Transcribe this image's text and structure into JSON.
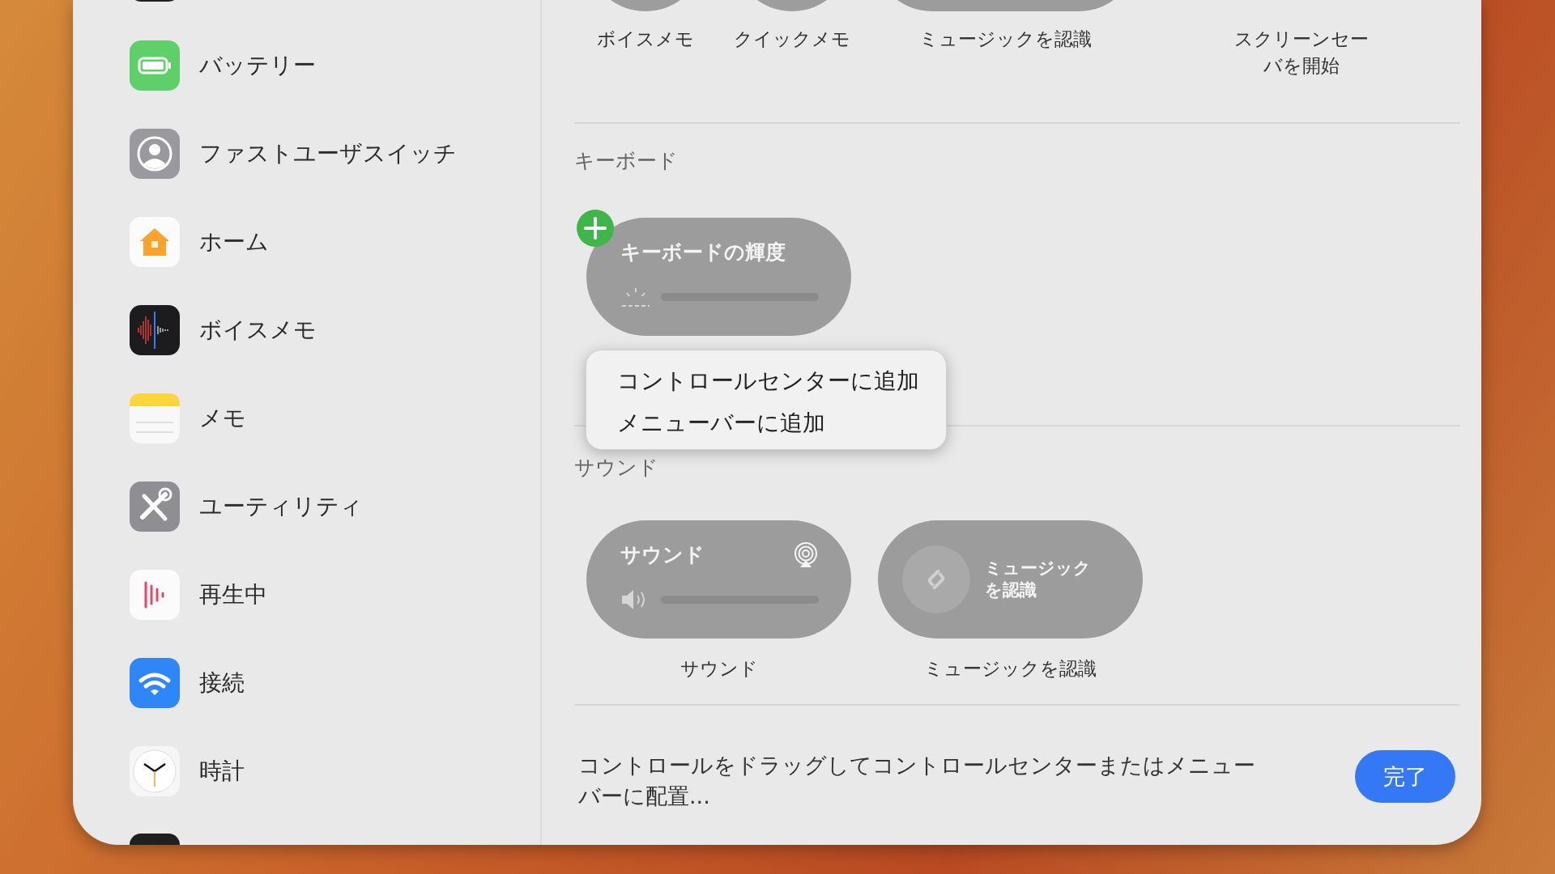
{
  "sidebar": {
    "items": [
      {
        "label": "バッテリー"
      },
      {
        "label": "ファストユーザスイッチ"
      },
      {
        "label": "ホーム"
      },
      {
        "label": "ボイスメモ"
      },
      {
        "label": "メモ"
      },
      {
        "label": "ユーティリティ"
      },
      {
        "label": "再生中"
      },
      {
        "label": "接続"
      },
      {
        "label": "時計"
      }
    ]
  },
  "gallery_top": [
    {
      "kind": "circle",
      "caption": "ボイスメモ"
    },
    {
      "kind": "circle",
      "caption": "クイックメモ"
    },
    {
      "kind": "pill",
      "caption": "ミュージックを認識"
    },
    {
      "kind": "none",
      "caption": "スクリーンセーバを開始"
    }
  ],
  "sections": [
    {
      "title": "キーボード",
      "controls": [
        {
          "kind": "brightness_slider",
          "title": "キーボードの輝度",
          "add_badge": true,
          "airplay": false
        }
      ]
    },
    {
      "title": "サウンド",
      "controls": [
        {
          "kind": "volume_slider",
          "title": "サウンド",
          "add_badge": false,
          "airplay": true,
          "caption": "サウンド"
        },
        {
          "kind": "button",
          "title": "ミュージックを認識",
          "add_badge": false,
          "caption": "ミュージックを認識"
        }
      ]
    }
  ],
  "context_menu": {
    "items": [
      "コントロールセンターに追加",
      "メニューバーに追加"
    ]
  },
  "footer": {
    "hint": "コントロールをドラッグしてコントロールセンターまたはメニューバーに配置...",
    "done_button": "完了"
  }
}
